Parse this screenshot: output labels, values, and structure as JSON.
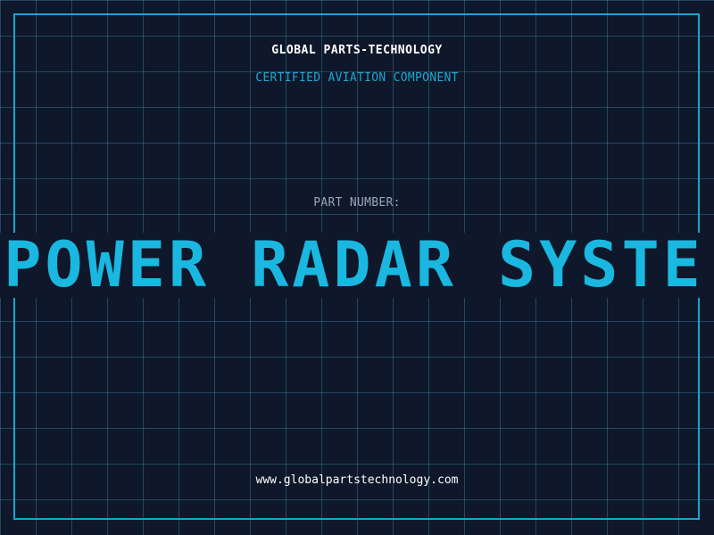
{
  "header": {
    "company": "GLOBAL PARTS-TECHNOLOGY",
    "tagline": "CERTIFIED AVIATION COMPONENT"
  },
  "part": {
    "label": "PART NUMBER:",
    "value": "N POWER RADAR SYSTE"
  },
  "footer": {
    "url": "www.globalpartstechnology.com"
  },
  "colors": {
    "background": "#0f172a",
    "grid": "#38829f",
    "frame": "#1aa5cf",
    "accent": "#1ab8e0"
  }
}
